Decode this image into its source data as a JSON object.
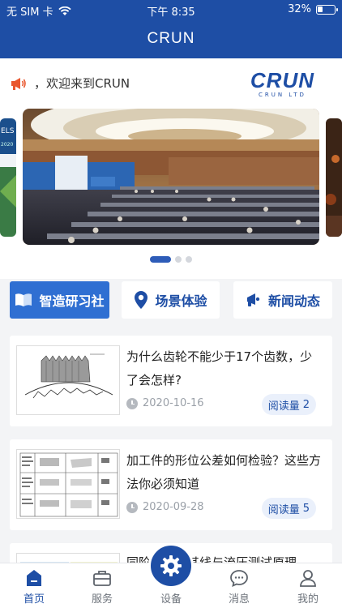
{
  "status_bar": {
    "carrier": "无 SIM 卡",
    "time": "下午 8:35",
    "battery": "32%",
    "battery_level": 0.32
  },
  "header": {
    "title": "CRUN"
  },
  "notice": {
    "text": "，欢迎来到CRUN",
    "icon": "megaphone-icon"
  },
  "logo": {
    "word": "CRUN",
    "sub": "CRUN LTD"
  },
  "banner": {
    "slide_count": 3,
    "active_index": 0,
    "left_peek_text": [
      "ELS",
      "2020"
    ]
  },
  "quick_links": [
    {
      "label": "智造研习社",
      "icon": "book-icon"
    },
    {
      "label": "场景体验",
      "icon": "location-pin-icon"
    },
    {
      "label": "新闻动态",
      "icon": "megaphone-icon"
    }
  ],
  "articles": [
    {
      "title": "为什么齿轮不能少于17个齿数，少了会怎样?",
      "date": "2020-10-16",
      "reads_label": "阅读量",
      "reads": "2"
    },
    {
      "title": "加工件的形位公差如何检验？这些方法你必须知道",
      "date": "2020-09-28",
      "reads_label": "阅读量",
      "reads": "5"
    },
    {
      "title": "同步……",
      "date": "",
      "reads_label": "",
      "reads": ""
    }
  ],
  "article3_visible_title": "同阶……数其线与流压测试原理",
  "tabbar": [
    {
      "label": "首页",
      "icon": "home-icon",
      "active": true
    },
    {
      "label": "服务",
      "icon": "briefcase-icon",
      "active": false
    },
    {
      "label": "设备",
      "icon": "gear-icon",
      "active": false
    },
    {
      "label": "消息",
      "icon": "chat-bubble-icon",
      "active": false
    },
    {
      "label": "我的",
      "icon": "user-icon",
      "active": false
    }
  ],
  "colors": {
    "brand": "#1e4ea5",
    "accent": "#2f6fd2",
    "notice_icon": "#e9572e"
  }
}
